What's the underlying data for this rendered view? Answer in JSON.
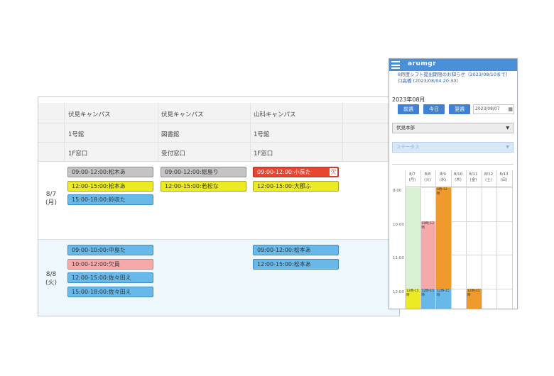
{
  "desktop": {
    "columns": [
      {
        "campus": "伏見キャンパス",
        "building": "1号館",
        "counter": "1F窓口"
      },
      {
        "campus": "伏見キャンパス",
        "building": "図書館",
        "counter": "受付窓口"
      },
      {
        "campus": "山科キャンパス",
        "building": "1号館",
        "counter": "1F窓口"
      }
    ],
    "days": [
      {
        "date": "8/7",
        "weekday": "(月)",
        "events": [
          {
            "col": 0,
            "slot": 0,
            "label": "09:00-12:00:松木あ",
            "color": "gray"
          },
          {
            "col": 0,
            "slot": 1,
            "label": "12:00-15:00:松本あ",
            "color": "yellow"
          },
          {
            "col": 0,
            "slot": 2,
            "label": "15:00-18:00:鈴収た",
            "color": "blue"
          },
          {
            "col": 1,
            "slot": 0,
            "label": "09:00-12:00:総島り",
            "color": "gray"
          },
          {
            "col": 1,
            "slot": 1,
            "label": "12:00-15:00:若松な",
            "color": "yellow"
          },
          {
            "col": 2,
            "slot": 0,
            "label": "09:00-12:00:小長た",
            "color": "red",
            "tag": "欠"
          },
          {
            "col": 2,
            "slot": 1,
            "label": "12:00-15:00:大郡ふ",
            "color": "yellow"
          }
        ]
      },
      {
        "date": "8/8",
        "weekday": "(火)",
        "events": [
          {
            "col": 0,
            "slot": 0,
            "label": "09:00-10:00:中島た",
            "color": "blue"
          },
          {
            "col": 0,
            "slot": 1,
            "label": "10:00-12:00:欠員",
            "color": "pink"
          },
          {
            "col": 0,
            "slot": 2,
            "label": "12:00-15:00:佐々田え",
            "color": "blue"
          },
          {
            "col": 0,
            "slot": 3,
            "label": "15:00-18:00:佐々田え",
            "color": "blue"
          },
          {
            "col": 2,
            "slot": 0,
            "label": "09:00-12:00:松本あ",
            "color": "blue"
          },
          {
            "col": 2,
            "slot": 1,
            "label": "12:00-15:00:松本あ",
            "color": "blue"
          }
        ]
      }
    ]
  },
  "mobile": {
    "app_title": "arumgr",
    "notice_line1": "8月度シフト提出期限のお知らせ（2023/08/10まで）",
    "notice_line2": "口高橋 (2023/08/04 20:30)",
    "month": "2023年08月",
    "buttons": {
      "prev": "前週",
      "today": "今日",
      "next": "翌週"
    },
    "date_value": "2023/08/07",
    "location_select": "伏見本部",
    "status_select": "ステータス",
    "week_days": [
      {
        "date": "8/7",
        "wd": "(月)"
      },
      {
        "date": "8/8",
        "wd": "(火)"
      },
      {
        "date": "8/9",
        "wd": "(水)"
      },
      {
        "date": "8/10",
        "wd": "(木)"
      },
      {
        "date": "8/11",
        "wd": "(金)"
      },
      {
        "date": "8/12",
        "wd": "(土)"
      },
      {
        "date": "8/13",
        "wd": "(日)"
      }
    ],
    "hours": [
      "9:00",
      "10:00",
      "11:00",
      "12:00"
    ],
    "blocks": [
      {
        "day": 0,
        "start": 9.0,
        "end": 12.6,
        "color": "#d9f0d2",
        "label": ""
      },
      {
        "day": 0,
        "start": 12.0,
        "end": 12.6,
        "color": "#ecea24",
        "label": "12時-15時"
      },
      {
        "day": 1,
        "start": 10.0,
        "end": 12.0,
        "color": "#f5a9a8",
        "label": "10時-12時"
      },
      {
        "day": 1,
        "start": 12.0,
        "end": 12.6,
        "color": "#68b9ea",
        "label": "12時-15時"
      },
      {
        "day": 2,
        "start": 9.0,
        "end": 12.0,
        "color": "#ee9a2c",
        "label": "9時-12時"
      },
      {
        "day": 2,
        "start": 12.0,
        "end": 12.6,
        "color": "#68b9ea",
        "label": "12時-15時"
      },
      {
        "day": 4,
        "start": 12.0,
        "end": 12.6,
        "color": "#ee9a2c",
        "label": "12時-15時"
      }
    ]
  }
}
